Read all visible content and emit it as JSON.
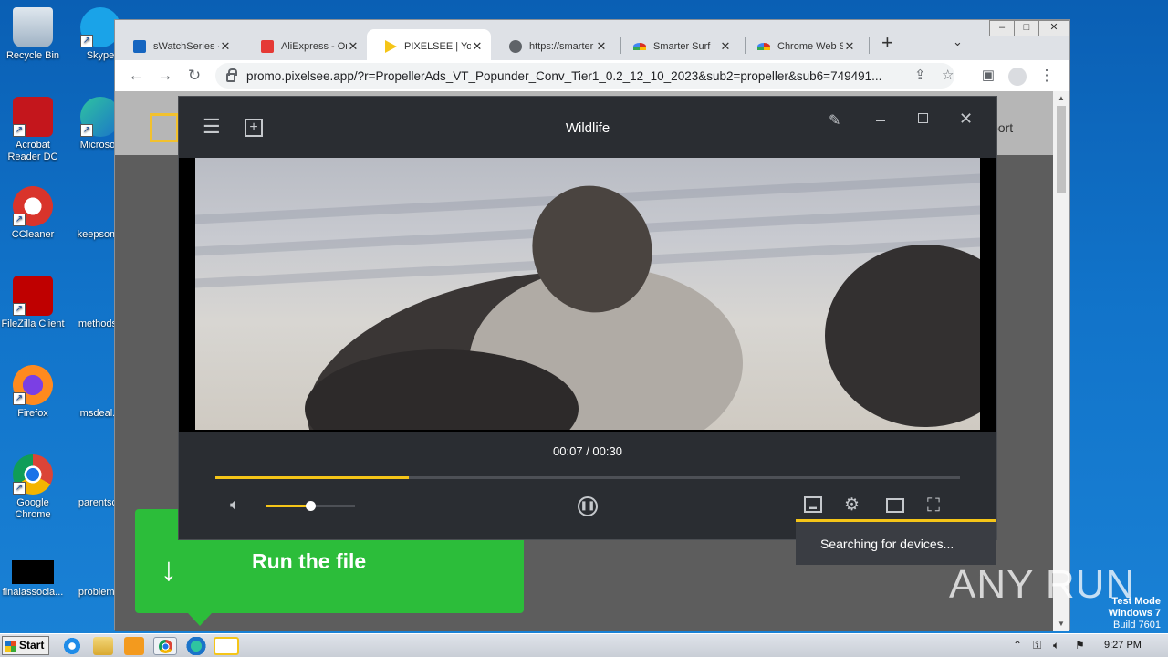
{
  "desktop": {
    "icons": [
      {
        "label": "Recycle Bin"
      },
      {
        "label": "Skype"
      },
      {
        "label": "Acrobat Reader DC"
      },
      {
        "label": "Microsoft"
      },
      {
        "label": "CCleaner"
      },
      {
        "label": "keepsome"
      },
      {
        "label": "FileZilla Client"
      },
      {
        "label": "methodsp"
      },
      {
        "label": "Firefox"
      },
      {
        "label": "msdeal.p"
      },
      {
        "label": "Google Chrome"
      },
      {
        "label": "parentsca"
      },
      {
        "label": "finalassocia..."
      },
      {
        "label": "problemdi"
      }
    ],
    "watermark": {
      "line1": "Test Mode",
      "line2": "Windows 7",
      "line3": "Build 7601"
    }
  },
  "browser": {
    "tabs": [
      {
        "title": "sWatchSeries -",
        "favicon_color": "#1565c0"
      },
      {
        "title": "AliExpress - Or",
        "favicon_color": "#e53935"
      },
      {
        "title": "PIXELSEE | You",
        "favicon_color": "#f5c518"
      },
      {
        "title": "https://smarter",
        "favicon_color": "#5f6368"
      },
      {
        "title": "Smarter Surf",
        "favicon_color": "#d93025"
      },
      {
        "title": "Chrome Web S",
        "favicon_color": "#d93025"
      }
    ],
    "close_glyph": "✕",
    "new_tab": "+",
    "tab_menu": "⌄",
    "window_controls": {
      "minimize": "‒",
      "maximize": "□",
      "close": "✕"
    },
    "nav": {
      "back": "←",
      "forward": "→",
      "reload": "↻"
    },
    "url": "promo.pixelsee.app/?r=PropellerAds_VT_Popunder_Conv_Tier1_0.2_12_10_2023&sub2=propeller&sub6=749491...",
    "page_link": "port"
  },
  "run_banner": {
    "label": "Run the file",
    "icon": "↓"
  },
  "player": {
    "title": "Wildlife",
    "current_time": "00:07 / 00:30",
    "progress": 0.26,
    "volume": 0.5,
    "casting_status": "Searching for devices..."
  },
  "anyrun_logo": "ANY RUN",
  "taskbar": {
    "start_label": "Start",
    "clock": "9:27 PM"
  },
  "colors": {
    "accent": "#f5c518",
    "run_green": "#2cbd3a",
    "player_bg": "#2a2d32"
  }
}
